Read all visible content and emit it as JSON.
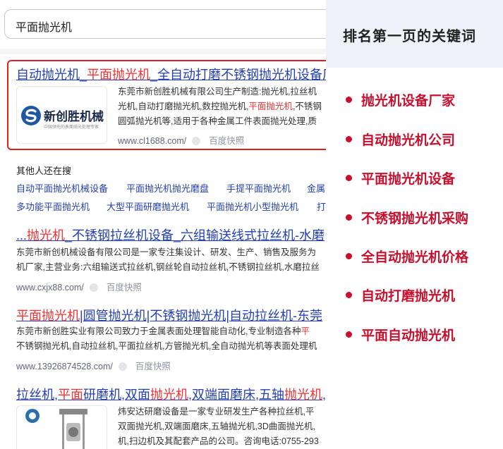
{
  "search": {
    "query": "平面抛光机"
  },
  "results": [
    {
      "title": [
        {
          "t": "自动抛光机",
          "hl": false
        },
        {
          "t": "_",
          "hl": false
        },
        {
          "t": "平面抛光机",
          "hl": true
        },
        {
          "t": "_全自动打磨不锈钢抛光机设备厂",
          "hl": false
        }
      ],
      "snippet": [
        [
          {
            "t": "东莞市新创胜机械有限公司生产制造:抛光机,拉丝机",
            "hl": false
          }
        ],
        [
          {
            "t": "光机,自动打磨抛光机,数控抛光机,",
            "hl": false
          },
          {
            "t": "平面抛光机",
            "hl": true
          },
          {
            "t": ",不锈钢",
            "hl": false
          }
        ],
        [
          {
            "t": "圆弧抛光机等,适用于各种金属工件表面抛光处理,质",
            "hl": false
          }
        ]
      ],
      "url": "www.cl1688.com/",
      "kuaizhao": "百度快照",
      "logo_text": "新创胜机械",
      "logo_sub": "中国领先的表面抛光处理专家"
    },
    {
      "title": [
        {
          "t": "...",
          "hl": false
        },
        {
          "t": "抛光机",
          "hl": true
        },
        {
          "t": "_不锈钢拉丝机设备_六组输送线式拉丝机-水磨",
          "hl": false
        }
      ],
      "snippet": [
        [
          {
            "t": "东莞市新创机械设备有限公司是一家专注集设计、研发、生产、销售及服务为",
            "hl": false
          }
        ],
        [
          {
            "t": "机厂家,主营业务:六组输送式拉丝机,钢丝轮自动拉丝机,不锈钢拉丝机,水磨拉丝",
            "hl": false
          }
        ]
      ],
      "url": "www.cxjx88.com/",
      "kuaizhao": "百度快照"
    },
    {
      "title": [
        {
          "t": "平面抛光机",
          "hl": true
        },
        {
          "t": "|圆管抛光机|不锈钢抛光机|自动拉丝机-东莞",
          "hl": false
        }
      ],
      "snippet": [
        [
          {
            "t": "东莞市新创胜实业有限公司致力于金属表面处理智能自动化,专业制造各种",
            "hl": false
          },
          {
            "t": "平",
            "hl": true
          }
        ],
        [
          {
            "t": "不锈钢抛光机,自动拉丝机,平面拉丝机,方管抛光机,全自动抛光机等表面处理机",
            "hl": false
          }
        ]
      ],
      "url": "www.13926874528.com/",
      "kuaizhao": "百度快照"
    },
    {
      "title": [
        {
          "t": "拉丝机,",
          "hl": false
        },
        {
          "t": "平面",
          "hl": true
        },
        {
          "t": "研磨机,双面",
          "hl": false
        },
        {
          "t": "抛光机",
          "hl": true
        },
        {
          "t": ",双端面磨床,五轴",
          "hl": false
        },
        {
          "t": "抛光机",
          "hl": true
        },
        {
          "t": ",",
          "hl": false
        }
      ],
      "snippet": [
        [
          {
            "t": "炜安达研磨设备是一家专业研发生产各种拉丝机,平",
            "hl": false
          }
        ],
        [
          {
            "t": "双面抛光机,双端面磨床,五轴抛光机,3D曲面抛光机,",
            "hl": false
          }
        ],
        [
          {
            "t": "机,扫边机及其配套产品的公司。咨询电话:0755-293",
            "hl": false
          }
        ]
      ]
    }
  ],
  "related": {
    "title": "其他人还在搜",
    "rows": [
      [
        "自动平面抛光机械设备",
        "平面抛光机抛光磨盘",
        "手提平面抛光机",
        "金属"
      ],
      [
        "多功能平面抛光机",
        "大型平面研磨抛光机",
        "平面抛光机小型抛光机",
        "打"
      ]
    ]
  },
  "panel": {
    "title": "排名第一页的关键词",
    "keywords": [
      "抛光机设备厂家",
      "自动抛光机公司",
      "平面抛光机设备",
      "不锈钢抛光机采购",
      "全自动抛光机价格",
      "自动打磨抛光机",
      "平面自动抛光机"
    ]
  },
  "colors": {
    "link": "#2440b3",
    "highlight": "#f73131",
    "keyword": "#c8102e",
    "box": "#e02020"
  }
}
